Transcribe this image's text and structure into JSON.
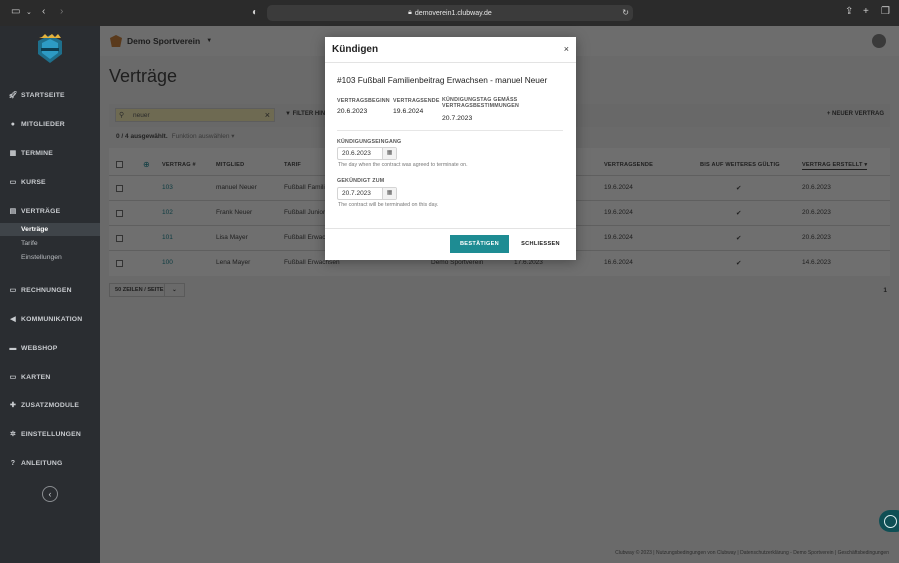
{
  "browser": {
    "url": "demoverein1.clubway.de"
  },
  "sidebar": {
    "items": [
      {
        "label": "STARTSEITE",
        "icon": "rocket-icon"
      },
      {
        "label": "MITGLIEDER",
        "icon": "user-icon"
      },
      {
        "label": "TERMINE",
        "icon": "calendar-icon"
      },
      {
        "label": "KURSE",
        "icon": "video-icon"
      },
      {
        "label": "VERTRÄGE",
        "icon": "contract-icon"
      },
      {
        "label": "RECHNUNGEN",
        "icon": "invoice-icon"
      },
      {
        "label": "KOMMUNIKATION",
        "icon": "megaphone-icon"
      },
      {
        "label": "WEBSHOP",
        "icon": "cart-icon"
      },
      {
        "label": "KARTEN",
        "icon": "card-icon"
      },
      {
        "label": "ZUSATZMODULE",
        "icon": "puzzle-icon"
      },
      {
        "label": "EINSTELLUNGEN",
        "icon": "gear-icon"
      },
      {
        "label": "ANLEITUNG",
        "icon": "question-icon"
      }
    ],
    "subitems": [
      "Verträge",
      "Tarife",
      "Einstellungen"
    ],
    "active_sub": "Verträge"
  },
  "header": {
    "club_name": "Demo Sportverein"
  },
  "page": {
    "title": "Verträge"
  },
  "toolbar": {
    "search_value": "neuer",
    "filter_label": "FILTER HINZ",
    "new_contract_label": "+ NEUER VERTRAG"
  },
  "selection": {
    "count": "0 / 4 ausgewählt.",
    "action": "Funktion auswählen ▾"
  },
  "table": {
    "headers": {
      "number": "VERTRAG #",
      "member": "MITGLIED",
      "tariff": "TARIF",
      "end": "VERTRAGSENDE",
      "until": "BIS AUF WEITERES GÜLTIG",
      "created": "VERTRAG ERSTELLT ▾"
    },
    "rows": [
      {
        "number": "103",
        "member": "manuel Neuer",
        "tariff": "Fußball Familie",
        "club": "",
        "start": "",
        "end": "19.6.2024",
        "until": "✔",
        "created": "20.6.2023"
      },
      {
        "number": "102",
        "member": "Frank Neuer",
        "tariff": "Fußball Junior",
        "club": "",
        "start": "",
        "end": "19.6.2024",
        "until": "✔",
        "created": "20.6.2023"
      },
      {
        "number": "101",
        "member": "Lisa Mayer",
        "tariff": "Fußball Erwach",
        "club": "",
        "start": "",
        "end": "19.6.2024",
        "until": "✔",
        "created": "20.6.2023"
      },
      {
        "number": "100",
        "member": "Lena Mayer",
        "tariff": "Fußball Erwachsen",
        "club": "Demo Sportverein",
        "start": "17.6.2023",
        "end": "16.6.2024",
        "until": "✔",
        "created": "14.6.2023"
      }
    ]
  },
  "pagination": {
    "per_page": "50 ZEILEN / SEITE",
    "page": "1"
  },
  "footer": {
    "text": "Clubway © 2023  |  Nutzungsbedingungen von Clubway  |  Datenschutzerklärung - Demo Sportverein  |  Geschäftsbedingungen"
  },
  "modal": {
    "title": "Kündigen",
    "contract": "#103 Fußball Familienbeitrag Erwachsen - manuel Neuer",
    "start_label": "VERTRAGSBEGINN",
    "start_value": "20.6.2023",
    "end_label": "VERTRAGSENDE",
    "end_value": "19.6.2024",
    "termday_label": "KÜNDIGUNGSTAG GEMÄSS VERTRAGSBESTIMMUNGEN",
    "termday_value": "20.7.2023",
    "receipt_label": "KÜNDIGUNGSEINGANG",
    "receipt_value": "20.6.2023",
    "receipt_hint": "The day when the contract was agreed to terminate on.",
    "terminated_label": "GEKÜNDIGT ZUM",
    "terminated_value": "20.7.2023",
    "terminated_hint": "The contract will be terminated on this day.",
    "confirm_label": "BESTÄTIGEN",
    "close_label": "SCHLIESSEN"
  },
  "colors": {
    "accent": "#1e8c93",
    "sidebar": "#2a2d31"
  }
}
